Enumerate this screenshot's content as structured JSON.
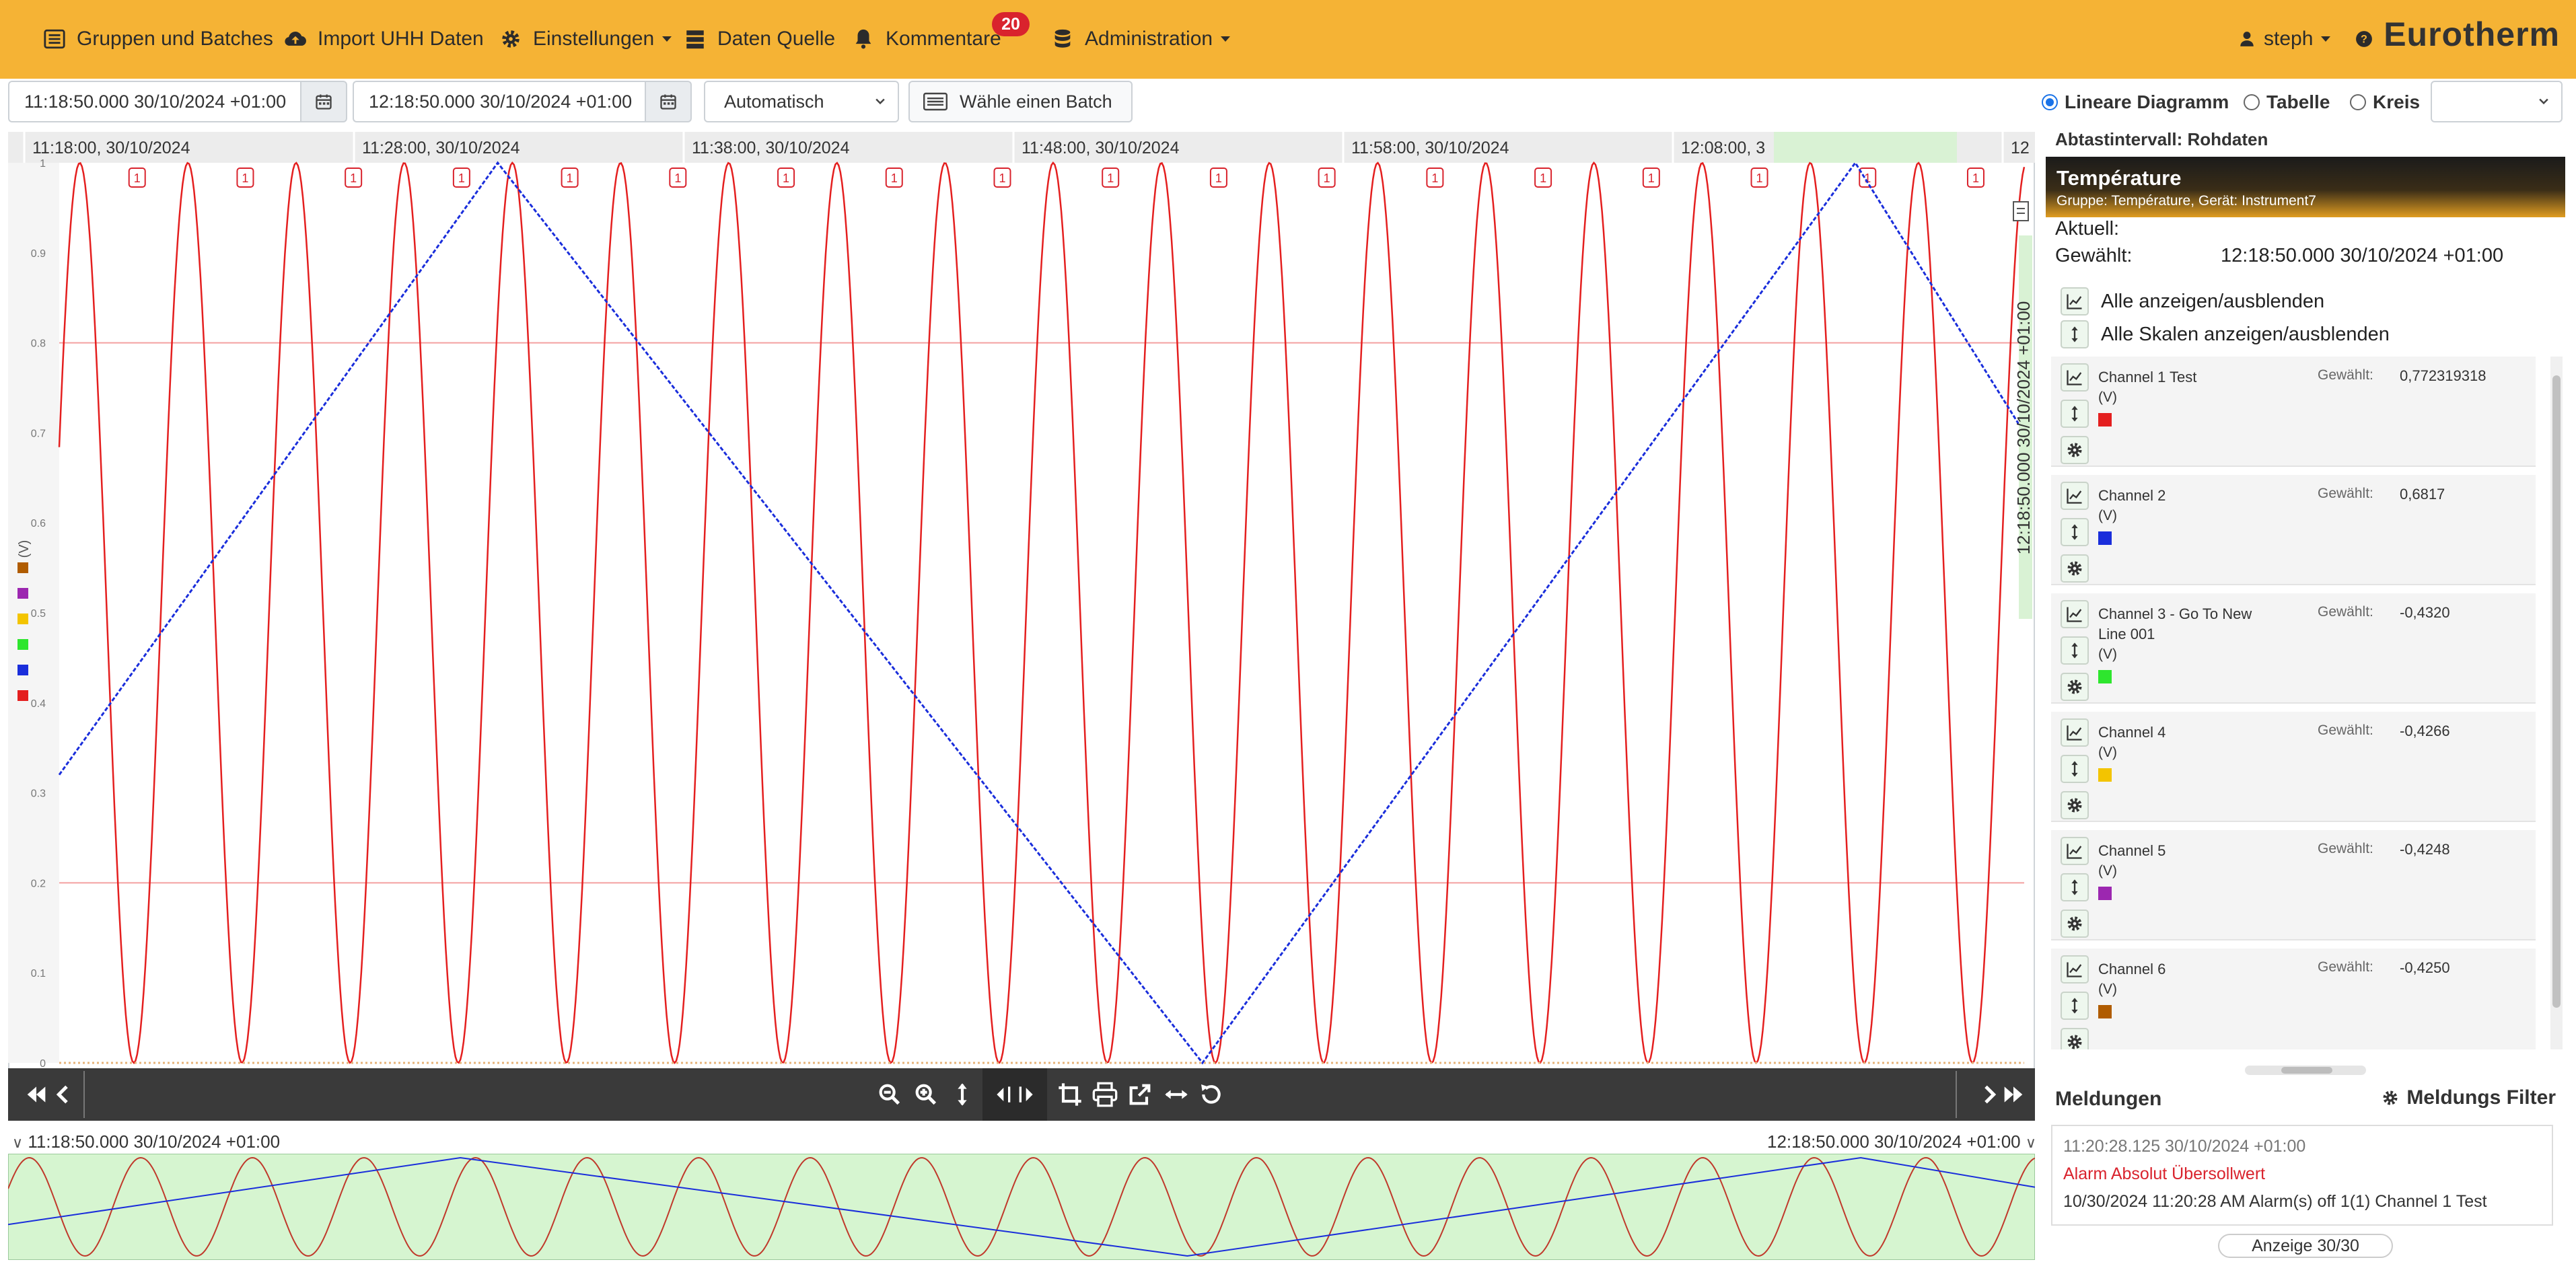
{
  "nav": {
    "items": [
      {
        "label": "Gruppen und Batches",
        "icon": "list-icon"
      },
      {
        "label": "Import UHH Daten",
        "icon": "cloud-upload-icon"
      },
      {
        "label": "Einstellungen",
        "icon": "gear-icon"
      },
      {
        "label": "Daten Quelle",
        "icon": "server-icon"
      },
      {
        "label": "Kommentare",
        "icon": "bell-icon"
      },
      {
        "label": "Administration",
        "icon": "database-icon"
      }
    ],
    "comments_badge": "20",
    "user": "steph",
    "help_icon": "question-icon",
    "brand": "Eurotherm"
  },
  "toolbar": {
    "start": "11:18:50.000 30/10/2024 +01:00",
    "end": "12:18:50.000 30/10/2024 +01:00",
    "mode": "Automatisch",
    "batch_button": "Wähle einen Batch",
    "view_options": [
      {
        "label": "Lineare Diagramm",
        "selected": true
      },
      {
        "label": "Tabelle",
        "selected": false
      },
      {
        "label": "Kreis",
        "selected": false
      }
    ]
  },
  "chart_data": {
    "type": "line",
    "ylabel": "(V)",
    "ylim": [
      0,
      1
    ],
    "yticks": [
      "0",
      "0.1",
      "0.2",
      "0.3",
      "0.4",
      "0.5",
      "0.6",
      "0.7",
      "0.8",
      "0.9",
      "1"
    ],
    "x_labels": [
      "11:18:00, 30/10/2024",
      "11:28:00, 30/10/2024",
      "11:38:00, 30/10/2024",
      "11:48:00, 30/10/2024",
      "11:58:00, 30/10/2024",
      "12:08:00, 3",
      "12"
    ],
    "x_range_minutes": [
      0,
      60.5
    ],
    "thresholds": [
      0.2,
      0.8
    ],
    "cursor_label": "12:18:50.000 30/10/2024 +01:00",
    "alarm_marker": "1",
    "series": [
      {
        "name": "Channel 1 Test",
        "color": "#e41f1f",
        "shape": "sine",
        "period_minutes": 3.33,
        "min": 0,
        "max": 1
      },
      {
        "name": "Channel 2",
        "color": "#1a2edb",
        "shape": "triangle",
        "points": [
          [
            0,
            0.32
          ],
          [
            13.5,
            1.0
          ],
          [
            35.2,
            0.0
          ],
          [
            55.3,
            1.0
          ],
          [
            60.5,
            0.7
          ]
        ]
      }
    ],
    "legend_colors": [
      "#b05c00",
      "#9c27b0",
      "#f3c400",
      "#2ee62e",
      "#1a2edb",
      "#e41f1f"
    ],
    "overview_colors": {
      "background": "#d6f5d0"
    }
  },
  "controls": {
    "nav_icons": [
      "fast-backward-icon",
      "backward-icon",
      "zoom-out-icon",
      "zoom-in-icon",
      "vertical-resize-icon",
      "pan-icon",
      "crop-icon",
      "print-icon",
      "external-link-icon",
      "horizontal-resize-icon",
      "reset-icon",
      "forward-icon",
      "fast-forward-icon"
    ]
  },
  "overview": {
    "start": "11:18:50.000 30/10/2024 +01:00",
    "end": "12:18:50.000 30/10/2024 +01:00"
  },
  "panel": {
    "interval": "Abtastintervall: Rohdaten",
    "group_title": "Température",
    "group_sub": "Gruppe: Température, Gerät: Instrument7",
    "current_label": "Aktuell:",
    "selected_label": "Gewählt:",
    "selected_value": "12:18:50.000 30/10/2024 +01:00",
    "toggle_all": "Alle anzeigen/ausblenden",
    "toggle_scales": "Alle Skalen anzeigen/ausblenden",
    "channels": [
      {
        "name": "Channel 1 Test",
        "unit": "(V)",
        "color": "#e41f1f",
        "value_label": "Gewählt:",
        "value": "0,772319318"
      },
      {
        "name": "Channel 2",
        "unit": "(V)",
        "color": "#1a2edb",
        "value_label": "Gewählt:",
        "value": "0,6817"
      },
      {
        "name": "Channel 3 - Go To New Line 001",
        "unit": "(V)",
        "color": "#2ee62e",
        "value_label": "Gewählt:",
        "value": "-0,4320"
      },
      {
        "name": "Channel 4",
        "unit": "(V)",
        "color": "#f3c400",
        "value_label": "Gewählt:",
        "value": "-0,4266"
      },
      {
        "name": "Channel 5",
        "unit": "(V)",
        "color": "#9c27b0",
        "value_label": "Gewählt:",
        "value": "-0,4248"
      },
      {
        "name": "Channel 6",
        "unit": "(V)",
        "color": "#b05c00",
        "value_label": "Gewählt:",
        "value": "-0,4250"
      }
    ],
    "messages_title": "Meldungen",
    "messages_filter": "Meldungs Filter",
    "message": {
      "time": "11:20:28.125 30/10/2024 +01:00",
      "type": "Alarm Absolut Übersollwert",
      "text": "10/30/2024 11:20:28 AM Alarm(s) off 1(1) Channel 1 Test"
    },
    "count": "Anzeige 30/30"
  }
}
